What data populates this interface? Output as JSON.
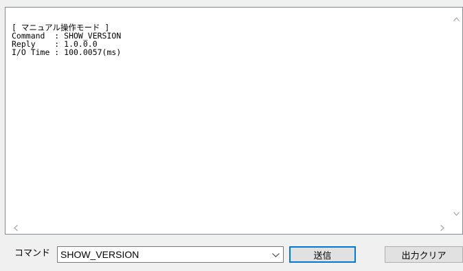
{
  "output": {
    "lines": [
      "[ マニュアル操作モード ]",
      "Command  : SHOW_VERSION",
      "Reply    : 1.0.0.0",
      "I/O Time : 100.0057(ms)"
    ]
  },
  "command_bar": {
    "label": "コマンド",
    "selected_command": "SHOW_VERSION",
    "send_label": "送信",
    "clear_label": "出力クリア"
  },
  "colors": {
    "focus_border": "#0078d7",
    "scroll_arrow": "#a3a3a3"
  },
  "icons": {
    "scroll_up": "chevron-up-icon",
    "scroll_down": "chevron-down-icon",
    "scroll_left": "chevron-left-icon",
    "scroll_right": "chevron-right-icon",
    "dropdown": "chevron-down-icon"
  }
}
